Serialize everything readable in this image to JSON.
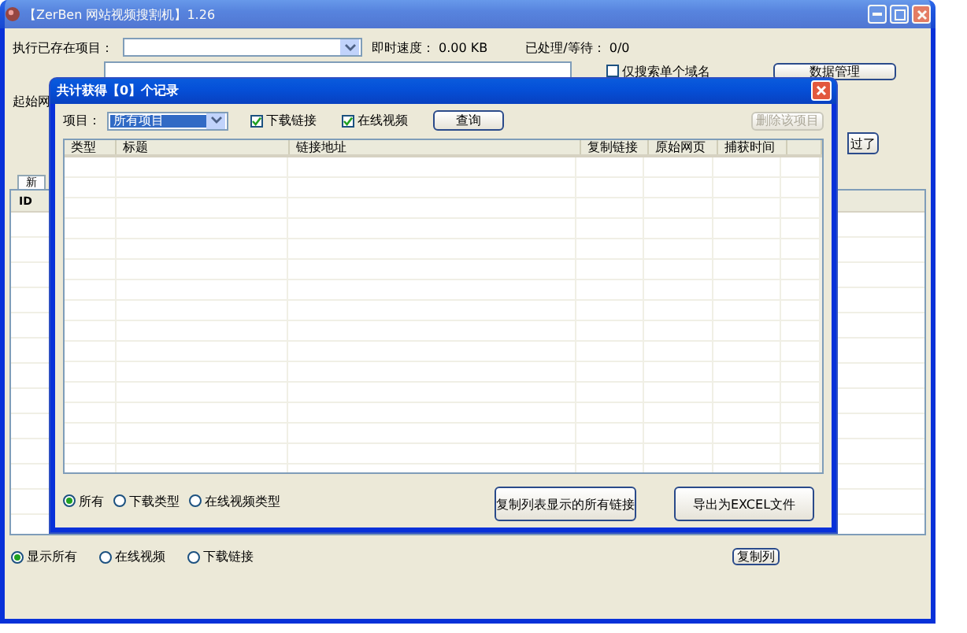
{
  "window": {
    "title": "【ZerBen 网站视频搜割机】1.26"
  },
  "top_row": {
    "project_label": "执行已存在项目：",
    "speed": "即时速度： 0.00 KB",
    "progress": "已处理/等待： 0/0"
  },
  "single_domain": {
    "label": "仅搜索单个域名",
    "checked": false
  },
  "data_button": "数据管理",
  "start_label": "起始网",
  "side_button": "过了",
  "tabs": [
    {
      "label": "新",
      "selected": true
    }
  ],
  "grid": {
    "columns": [
      "ID"
    ]
  },
  "filters": [
    {
      "label": "显示所有",
      "selected": true
    },
    {
      "label": "在线视频",
      "selected": false
    },
    {
      "label": "下载链接",
      "selected": false
    }
  ],
  "copy_button": "复制列",
  "dialog": {
    "title": "共计获得【0】个记录",
    "project_label": "项目：",
    "project_value": "所有项目",
    "checks": [
      {
        "label": "下载链接",
        "checked": true
      },
      {
        "label": "在线视频",
        "checked": true
      }
    ],
    "query_button": "查询",
    "delete_button": {
      "label": "删除该项目",
      "disabled": true
    },
    "columns": [
      "类型",
      "标题",
      "链接地址",
      "复制链接",
      "原始网页",
      "捕获时间"
    ],
    "types": [
      {
        "label": "所有",
        "selected": true
      },
      {
        "label": "下载类型",
        "selected": false
      },
      {
        "label": "在线视频类型",
        "selected": false
      }
    ],
    "buttons": [
      "复制列表显示的所有链接",
      "导出为EXCEL文件"
    ]
  }
}
